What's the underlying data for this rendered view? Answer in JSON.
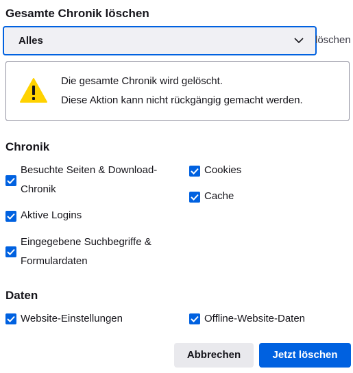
{
  "dialog": {
    "title": "Gesamte Chronik löschen",
    "time_range": {
      "selected": "Alles",
      "suffix": "löschen"
    },
    "warning": {
      "icon": "warning-icon",
      "line1": "Die gesamte Chronik wird gelöscht.",
      "line2": "Diese Aktion kann nicht rückgängig gemacht werden."
    },
    "history_section": {
      "title": "Chronik",
      "items": [
        {
          "line1": "Besuchte Seiten & Download-",
          "line2": "Chronik",
          "checked": true
        },
        {
          "line1": "Cookies",
          "checked": true
        },
        {
          "line1": "Cache",
          "checked": true
        },
        {
          "line1": "Aktive Logins",
          "checked": true
        },
        {
          "line1": "Eingegebene Suchbegriffe &",
          "line2": "Formulardaten",
          "checked": true
        }
      ]
    },
    "data_section": {
      "title": "Daten",
      "items": [
        {
          "line1": "Website-Einstellungen",
          "checked": true
        },
        {
          "line1": "Offline-Website-Daten",
          "checked": true
        }
      ]
    },
    "buttons": {
      "cancel": "Abbrechen",
      "confirm": "Jetzt löschen"
    },
    "colors": {
      "accent": "#0061e0",
      "warning": "#ffd200"
    }
  }
}
